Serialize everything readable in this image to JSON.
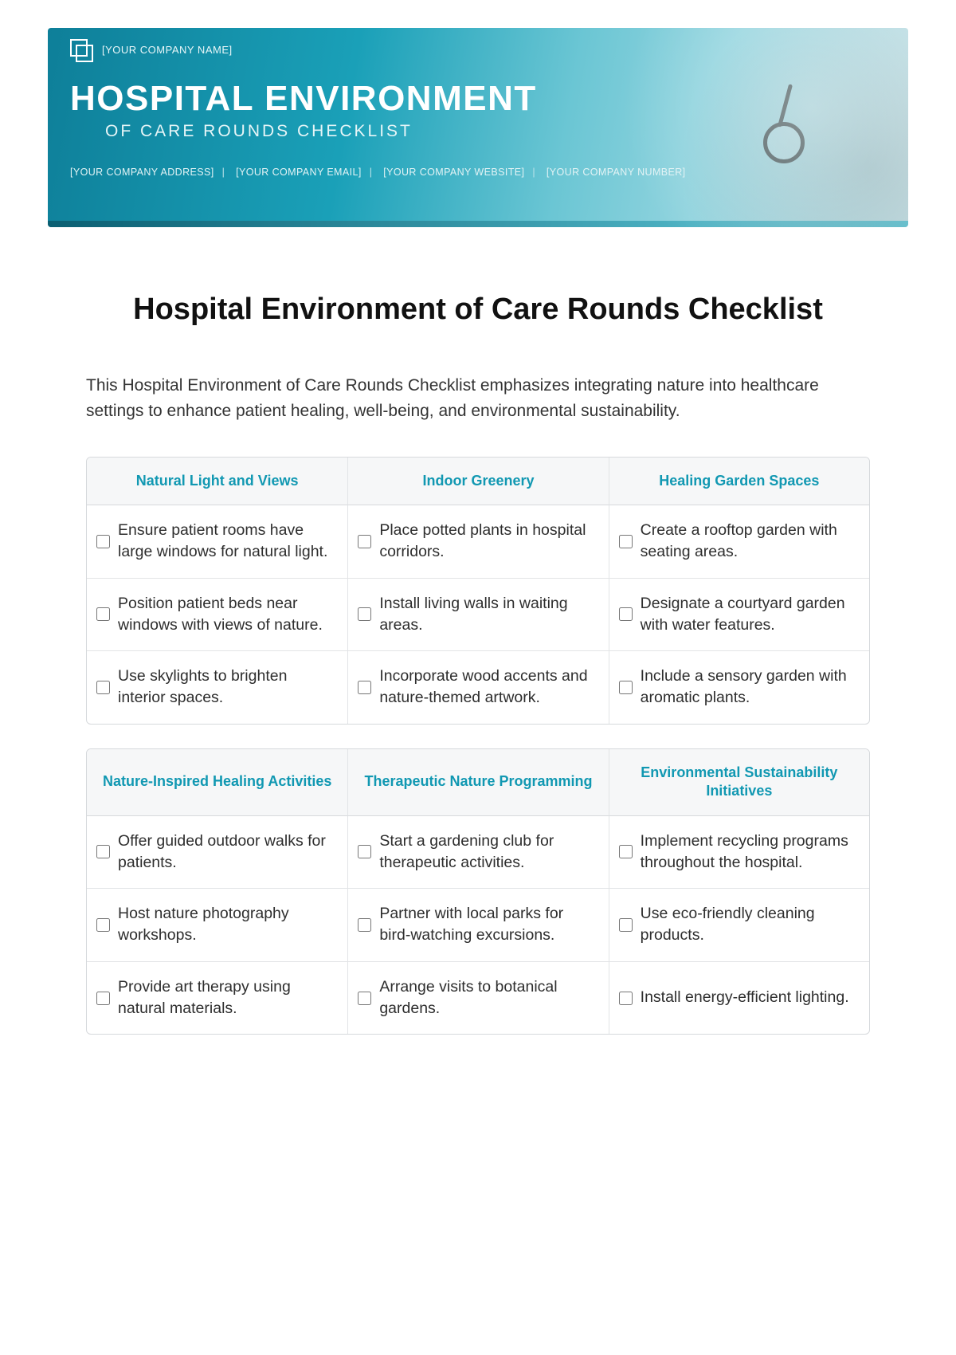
{
  "header": {
    "company_name": "[YOUR COMPANY NAME]",
    "title": "HOSPITAL ENVIRONMENT",
    "subtitle": "OF CARE ROUNDS CHECKLIST",
    "contacts": [
      "[YOUR COMPANY ADDRESS]",
      "[YOUR COMPANY EMAIL]",
      "[YOUR COMPANY WEBSITE]",
      "[YOUR COMPANY NUMBER]"
    ]
  },
  "doc_title": "Hospital Environment of Care Rounds Checklist",
  "intro": "This  Hospital Environment of Care Rounds Checklist emphasizes integrating nature into healthcare settings to enhance patient healing, well-being, and environmental sustainability.",
  "tables": [
    {
      "headers": [
        "Natural Light and Views",
        "Indoor Greenery",
        "Healing Garden Spaces"
      ],
      "rows": [
        [
          "Ensure patient rooms have large windows for natural light.",
          "Place potted plants in hospital corridors.",
          "Create a rooftop garden with seating areas."
        ],
        [
          "Position patient beds near windows with views of nature.",
          "Install living walls in waiting areas.",
          "Designate a courtyard garden with water features."
        ],
        [
          "Use skylights to brighten interior spaces.",
          "Incorporate wood accents and nature-themed artwork.",
          "Include a sensory garden with aromatic plants."
        ]
      ]
    },
    {
      "headers": [
        "Nature-Inspired Healing Activities",
        "Therapeutic Nature Programming",
        "Environmental Sustainability Initiatives"
      ],
      "rows": [
        [
          "Offer guided outdoor walks for patients.",
          "Start a gardening club for therapeutic activities.",
          "Implement recycling programs throughout the hospital."
        ],
        [
          "Host nature photography workshops.",
          "Partner with local parks for bird-watching excursions.",
          "Use eco-friendly cleaning products."
        ],
        [
          "Provide art therapy using natural materials.",
          "Arrange visits to botanical gardens.",
          "Install energy-efficient lighting."
        ]
      ]
    }
  ]
}
